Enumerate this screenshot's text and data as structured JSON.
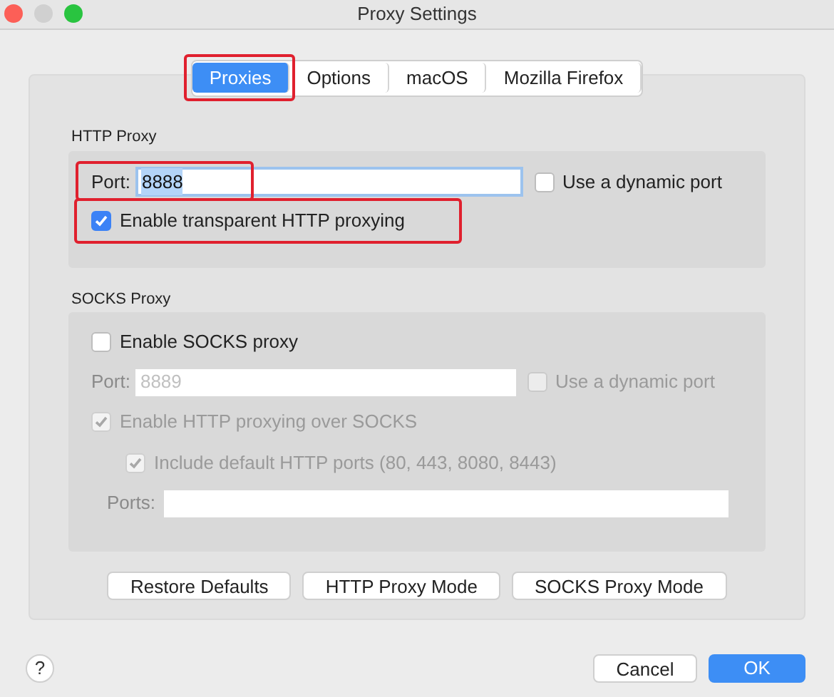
{
  "window": {
    "title": "Proxy Settings"
  },
  "tabs": [
    {
      "label": "Proxies",
      "selected": true,
      "highlighted": true
    },
    {
      "label": "Options",
      "selected": false,
      "highlighted": false
    },
    {
      "label": "macOS",
      "selected": false,
      "highlighted": false
    },
    {
      "label": "Mozilla Firefox",
      "selected": false,
      "highlighted": false
    }
  ],
  "http_proxy": {
    "heading": "HTTP Proxy",
    "port_label": "Port:",
    "port_value": "8888",
    "port_highlighted": true,
    "dynamic_port": {
      "label": "Use a dynamic port",
      "checked": false,
      "disabled": false
    },
    "transparent": {
      "label": "Enable transparent HTTP proxying",
      "checked": true,
      "disabled": false,
      "highlighted": true
    }
  },
  "socks_proxy": {
    "heading": "SOCKS Proxy",
    "enable": {
      "label": "Enable SOCKS proxy",
      "checked": false,
      "disabled": false
    },
    "port_label": "Port:",
    "port_placeholder": "8889",
    "dynamic_port": {
      "label": "Use a dynamic port",
      "checked": false,
      "disabled": true
    },
    "http_over_socks": {
      "label": "Enable HTTP proxying over SOCKS",
      "checked": true,
      "disabled": true
    },
    "default_ports": {
      "label": "Include default HTTP ports (80, 443, 8080, 8443)",
      "checked": true,
      "disabled": true
    },
    "ports_label": "Ports:"
  },
  "mode_buttons": [
    "Restore Defaults",
    "HTTP Proxy Mode",
    "SOCKS Proxy Mode"
  ],
  "help": "?",
  "footer_buttons": [
    {
      "label": "Cancel",
      "kind": "secondary"
    },
    {
      "label": "OK",
      "kind": "primary"
    }
  ]
}
